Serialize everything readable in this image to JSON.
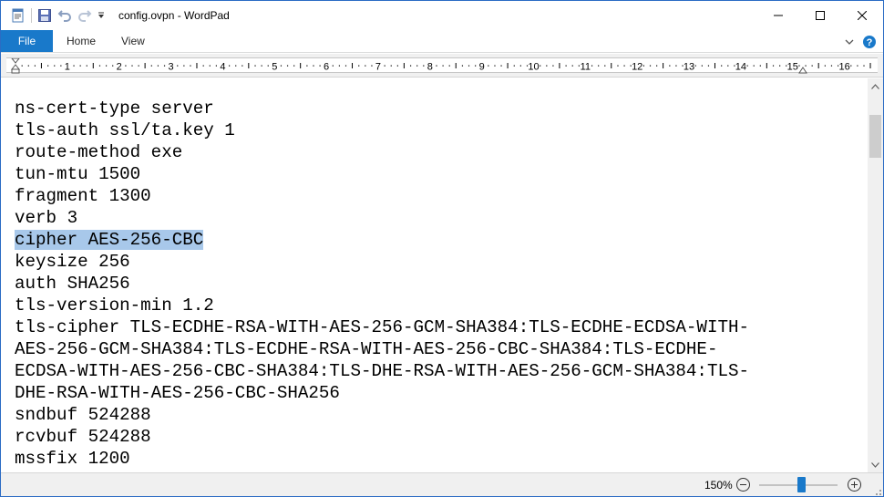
{
  "window": {
    "title": "config.ovpn - WordPad"
  },
  "ribbon": {
    "tabs": {
      "file": "File",
      "home": "Home",
      "view": "View"
    }
  },
  "ruler": {
    "numbers": [
      "1",
      "2",
      "3",
      "4",
      "5",
      "6",
      "7",
      "8",
      "9",
      "10",
      "11",
      "12",
      "13",
      "14",
      "15",
      "16"
    ]
  },
  "document": {
    "lines": [
      "ns-cert-type server",
      "tls-auth ssl/ta.key 1",
      "route-method exe",
      "tun-mtu 1500",
      "fragment 1300",
      "verb 3",
      "cipher AES-256-CBC",
      "keysize 256",
      "auth SHA256",
      "tls-version-min 1.2",
      "tls-cipher TLS-ECDHE-RSA-WITH-AES-256-GCM-SHA384:TLS-ECDHE-ECDSA-WITH-",
      "AES-256-GCM-SHA384:TLS-ECDHE-RSA-WITH-AES-256-CBC-SHA384:TLS-ECDHE-",
      "ECDSA-WITH-AES-256-CBC-SHA384:TLS-DHE-RSA-WITH-AES-256-GCM-SHA384:TLS-",
      "DHE-RSA-WITH-AES-256-CBC-SHA256",
      "sndbuf 524288",
      "rcvbuf 524288",
      "mssfix 1200"
    ],
    "selected_line": "cipher AES-256-CBC"
  },
  "statusbar": {
    "zoom": "150%",
    "zoom_level_fraction": 0.5
  },
  "colors": {
    "accent": "#1979ca",
    "selection": "#a8c8ea"
  },
  "icons": [
    "wordpad-app-icon",
    "save-icon",
    "undo-icon",
    "redo-icon",
    "customize-qat-icon",
    "minimize-icon",
    "maximize-icon",
    "close-icon",
    "collapse-ribbon-icon",
    "help-icon",
    "scroll-up-icon",
    "scroll-down-icon",
    "zoom-out-icon",
    "zoom-in-icon"
  ]
}
